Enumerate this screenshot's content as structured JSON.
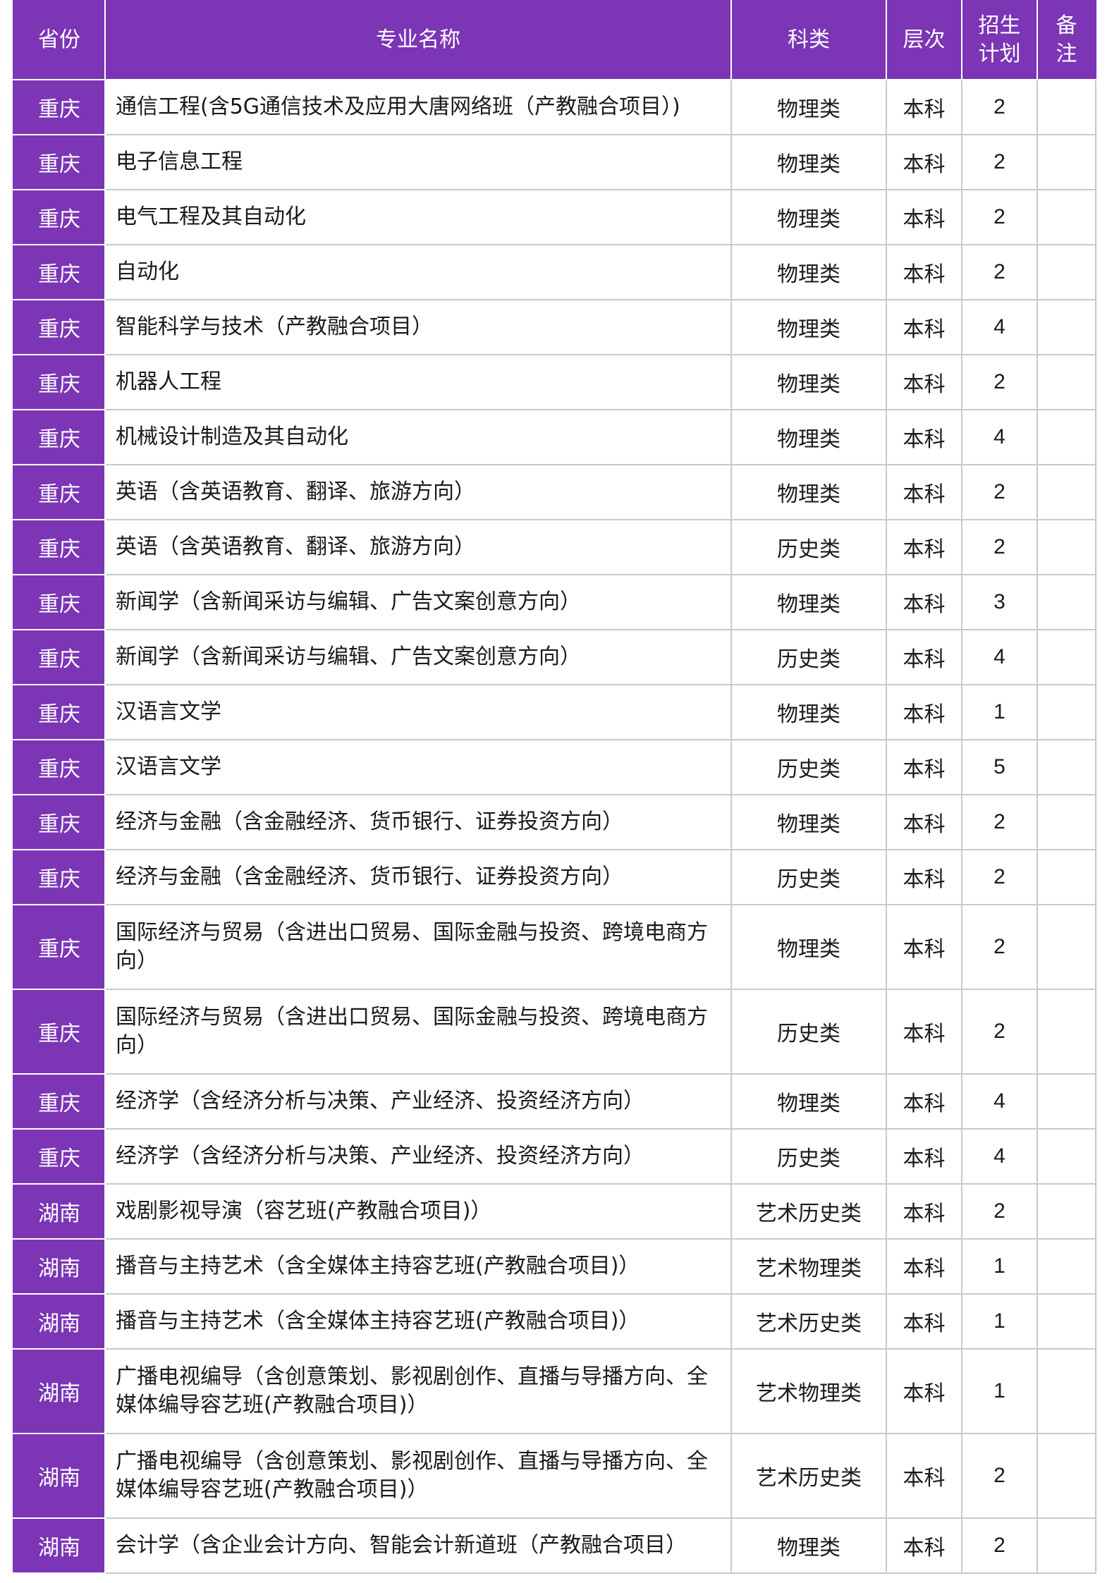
{
  "columns": {
    "province": "省份",
    "major": "专业名称",
    "category": "科类",
    "level": "层次",
    "plan_line1": "招生",
    "plan_line2": "计划",
    "note_line1": "备",
    "note_line2": "注"
  },
  "colors": {
    "header_bg": "#7b35b5",
    "header_text": "#ffffff",
    "grid": "#c9c9c9"
  },
  "rows": [
    {
      "province": "重庆",
      "major": "通信工程(含5G通信技术及应用大唐网络班（产教融合项目）)",
      "category": "物理类",
      "level": "本科",
      "plan": "2",
      "note": ""
    },
    {
      "province": "重庆",
      "major": "电子信息工程",
      "category": "物理类",
      "level": "本科",
      "plan": "2",
      "note": ""
    },
    {
      "province": "重庆",
      "major": "电气工程及其自动化",
      "category": "物理类",
      "level": "本科",
      "plan": "2",
      "note": ""
    },
    {
      "province": "重庆",
      "major": "自动化",
      "category": "物理类",
      "level": "本科",
      "plan": "2",
      "note": ""
    },
    {
      "province": "重庆",
      "major": "智能科学与技术（产教融合项目）",
      "category": "物理类",
      "level": "本科",
      "plan": "4",
      "note": ""
    },
    {
      "province": "重庆",
      "major": "机器人工程",
      "category": "物理类",
      "level": "本科",
      "plan": "2",
      "note": ""
    },
    {
      "province": "重庆",
      "major": "机械设计制造及其自动化",
      "category": "物理类",
      "level": "本科",
      "plan": "4",
      "note": ""
    },
    {
      "province": "重庆",
      "major": "英语（含英语教育、翻译、旅游方向）",
      "category": "物理类",
      "level": "本科",
      "plan": "2",
      "note": ""
    },
    {
      "province": "重庆",
      "major": "英语（含英语教育、翻译、旅游方向）",
      "category": "历史类",
      "level": "本科",
      "plan": "2",
      "note": ""
    },
    {
      "province": "重庆",
      "major": "新闻学（含新闻采访与编辑、广告文案创意方向）",
      "category": "物理类",
      "level": "本科",
      "plan": "3",
      "note": ""
    },
    {
      "province": "重庆",
      "major": "新闻学（含新闻采访与编辑、广告文案创意方向）",
      "category": "历史类",
      "level": "本科",
      "plan": "4",
      "note": ""
    },
    {
      "province": "重庆",
      "major": "汉语言文学",
      "category": "物理类",
      "level": "本科",
      "plan": "1",
      "note": ""
    },
    {
      "province": "重庆",
      "major": "汉语言文学",
      "category": "历史类",
      "level": "本科",
      "plan": "5",
      "note": ""
    },
    {
      "province": "重庆",
      "major": "经济与金融（含金融经济、货币银行、证券投资方向）",
      "category": "物理类",
      "level": "本科",
      "plan": "2",
      "note": ""
    },
    {
      "province": "重庆",
      "major": "经济与金融（含金融经济、货币银行、证券投资方向）",
      "category": "历史类",
      "level": "本科",
      "plan": "2",
      "note": ""
    },
    {
      "province": "重庆",
      "major": "国际经济与贸易（含进出口贸易、国际金融与投资、跨境电商方向）",
      "category": "物理类",
      "level": "本科",
      "plan": "2",
      "note": "",
      "tall": true
    },
    {
      "province": "重庆",
      "major": "国际经济与贸易（含进出口贸易、国际金融与投资、跨境电商方向）",
      "category": "历史类",
      "level": "本科",
      "plan": "2",
      "note": "",
      "tall": true
    },
    {
      "province": "重庆",
      "major": "经济学（含经济分析与决策、产业经济、投资经济方向）",
      "category": "物理类",
      "level": "本科",
      "plan": "4",
      "note": ""
    },
    {
      "province": "重庆",
      "major": "经济学（含经济分析与决策、产业经济、投资经济方向）",
      "category": "历史类",
      "level": "本科",
      "plan": "4",
      "note": ""
    },
    {
      "province": "湖南",
      "major": "戏剧影视导演（容艺班(产教融合项目)）",
      "category": "艺术历史类",
      "level": "本科",
      "plan": "2",
      "note": ""
    },
    {
      "province": "湖南",
      "major": "播音与主持艺术（含全媒体主持容艺班(产教融合项目)）",
      "category": "艺术物理类",
      "level": "本科",
      "plan": "1",
      "note": ""
    },
    {
      "province": "湖南",
      "major": "播音与主持艺术（含全媒体主持容艺班(产教融合项目)）",
      "category": "艺术历史类",
      "level": "本科",
      "plan": "1",
      "note": ""
    },
    {
      "province": "湖南",
      "major": "广播电视编导（含创意策划、影视剧创作、直播与导播方向、全媒体编导容艺班(产教融合项目)）",
      "category": "艺术物理类",
      "level": "本科",
      "plan": "1",
      "note": "",
      "tall": true
    },
    {
      "province": "湖南",
      "major": "广播电视编导（含创意策划、影视剧创作、直播与导播方向、全媒体编导容艺班(产教融合项目)）",
      "category": "艺术历史类",
      "level": "本科",
      "plan": "2",
      "note": "",
      "tall": true
    },
    {
      "province": "湖南",
      "major": "会计学（含企业会计方向、智能会计新道班（产教融合项目）",
      "category": "物理类",
      "level": "本科",
      "plan": "2",
      "note": ""
    }
  ]
}
